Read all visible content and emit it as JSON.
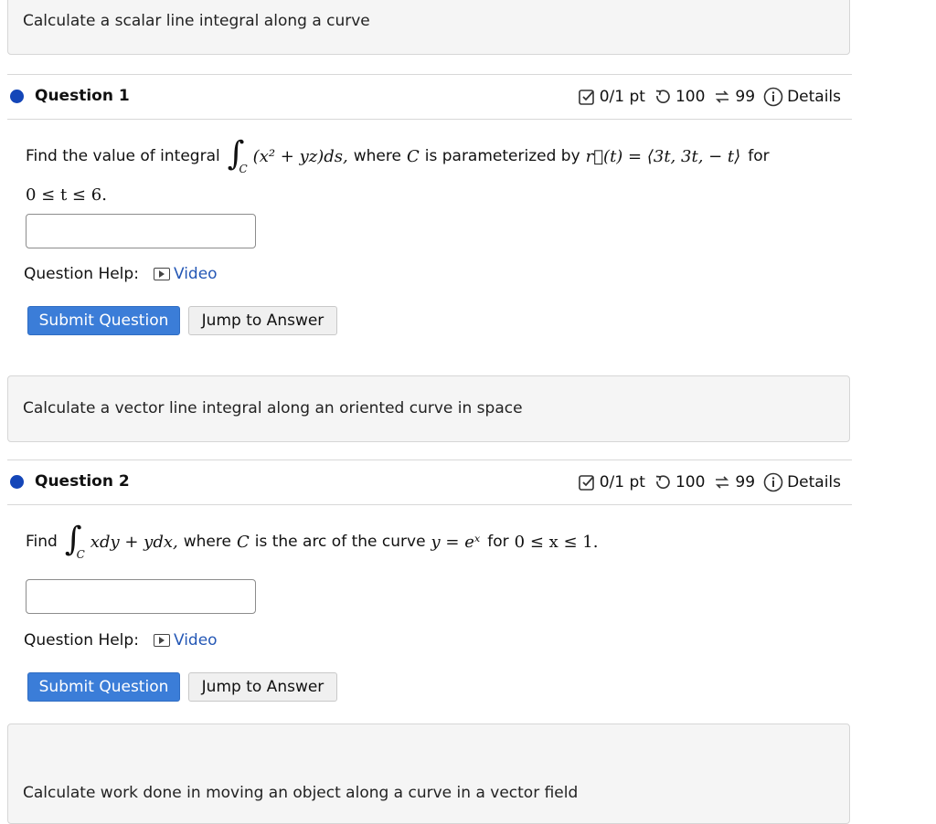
{
  "sections": [
    {
      "title": "Calculate a scalar line integral along a curve"
    },
    {
      "title": "Calculate a vector line integral along an oriented curve in space"
    },
    {
      "title": "Calculate work done in moving an object along a curve in a vector field"
    }
  ],
  "questions": [
    {
      "label": "Question 1",
      "score": "0/1 pt",
      "retries": "100",
      "attempts": "99",
      "details": "Details",
      "text_prefix": "Find the value of integral",
      "integrand": "(x² + yz)ds,",
      "integral_sub": "C",
      "text_middle": "where",
      "curve_var": "C",
      "text_middle2": "is parameterized by",
      "param": "r⃗(t) = ⟨3t, 3t, − t⟩",
      "text_suffix": "for",
      "range": "0 ≤ t ≤ 6.",
      "answer_value": "",
      "help_label": "Question Help:",
      "video_label": "Video",
      "submit_label": "Submit Question",
      "jump_label": "Jump to Answer"
    },
    {
      "label": "Question 2",
      "score": "0/1 pt",
      "retries": "100",
      "attempts": "99",
      "details": "Details",
      "text_prefix": "Find",
      "integrand": "xdy + ydx,",
      "integral_sub": "C",
      "text_middle": "where",
      "curve_var": "C",
      "text_middle2": "is the arc of the curve",
      "curve_eq": "y = eˣ",
      "text_suffix": "for",
      "range": "0 ≤ x ≤ 1.",
      "answer_value": "",
      "help_label": "Question Help:",
      "video_label": "Video",
      "submit_label": "Submit Question",
      "jump_label": "Jump to Answer"
    }
  ],
  "colors": {
    "accent": "#3b7dd8",
    "dot": "#1446b8",
    "link": "#2457b5"
  },
  "icons": [
    "checkbox-score-icon",
    "retry-icon",
    "attempts-icon",
    "info-icon",
    "video-icon"
  ]
}
